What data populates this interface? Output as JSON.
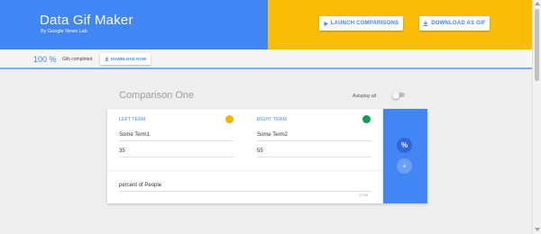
{
  "header": {
    "title": "Data Gif Maker",
    "subtitle": "By Google News Lab",
    "launch_label": "LAUNCH COMPARISONS",
    "download_gif_label": "DOWNLOAD AS GIF",
    "colors": {
      "left": "#4285f4",
      "right": "#fbbc05"
    }
  },
  "progress": {
    "percent": "100 %",
    "status_text": "Gifs completed",
    "download_now_label": "DOWNLOAD NOW"
  },
  "comparison": {
    "title": "Comparison One",
    "autoplay_label": "Autoplay all",
    "autoplay_on": false,
    "left": {
      "label": "LEFT TERM",
      "term": "Some Term1",
      "value": "35",
      "color": "#f4b400"
    },
    "right": {
      "label": "RIGHT TERM",
      "term": "Some Term2",
      "value": "55",
      "color": "#0f9d58"
    },
    "unit": "percent of People",
    "char_count": "17/30",
    "percent_button": "%",
    "add_button": "+"
  }
}
